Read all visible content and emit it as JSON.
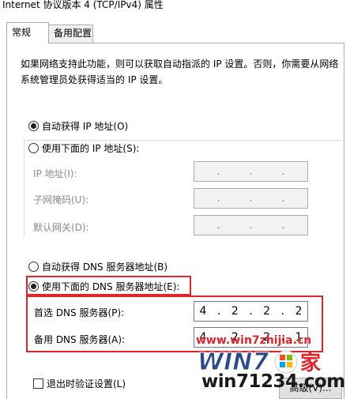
{
  "window": {
    "title": "Internet 协议版本 4 (TCP/IPv4) 属性"
  },
  "tabs": [
    {
      "label": "常规",
      "selected": true
    },
    {
      "label": "备用配置",
      "selected": false
    }
  ],
  "description": "如果网络支持此功能，则可以获取自动指派的 IP 设置。否则，你需要从网络系统管理员处获得适当的 IP 设置。",
  "ip_section": {
    "auto_label": "自动获得 IP 地址(O)",
    "auto_checked": true,
    "manual_label": "使用下面的 IP 地址(S):",
    "manual_checked": false,
    "fields": [
      {
        "label": "IP 地址(I):",
        "value": [
          "",
          "",
          "",
          ""
        ]
      },
      {
        "label": "子网掩码(U):",
        "value": [
          "",
          "",
          "",
          ""
        ]
      },
      {
        "label": "默认网关(D):",
        "value": [
          "",
          "",
          "",
          ""
        ]
      }
    ],
    "dot": "."
  },
  "dns_section": {
    "auto_label": "自动获得 DNS 服务器地址(B)",
    "auto_checked": false,
    "manual_label": "使用下面的 DNS 服务器地址(E):",
    "manual_checked": true,
    "preferred": {
      "label": "首选 DNS 服务器(P):",
      "octets": [
        "4",
        "2",
        "2",
        "2"
      ]
    },
    "alternate": {
      "label": "备用 DNS 服务器(A):",
      "octets": [
        "4",
        "2",
        "2",
        "1"
      ]
    }
  },
  "validate": {
    "label": "退出时验证设置(L)",
    "checked": false
  },
  "advanced_button": "高级(V)...",
  "watermark": {
    "site": "www.win7zhijia.cn",
    "url": "win71234.com",
    "logo_text": "WIN7"
  },
  "colors": {
    "highlight": "#e0242b",
    "disabled_text": "#8a8a8a",
    "tab_bg": "#f0f0f0"
  }
}
